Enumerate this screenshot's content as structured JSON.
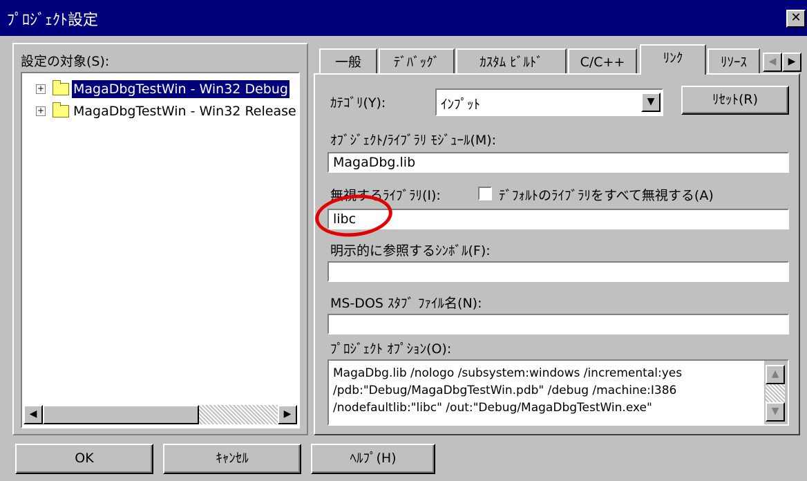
{
  "window": {
    "title": "ﾌﾟﾛｼﾞｪｸﾄ設定",
    "close_glyph": "✕"
  },
  "left": {
    "label": "設定の対象(S):",
    "tree_items": [
      {
        "label": "MagaDbgTestWin - Win32 Debug",
        "selected": true
      },
      {
        "label": "MagaDbgTestWin - Win32 Release",
        "selected": false
      }
    ]
  },
  "tabs": [
    {
      "label": "一般",
      "active": false
    },
    {
      "label": "ﾃﾞﾊﾞｯｸﾞ",
      "active": false
    },
    {
      "label": "ｶｽﾀﾑ ﾋﾞﾙﾄﾞ",
      "active": false
    },
    {
      "label": "C/C++",
      "active": false
    },
    {
      "label": "ﾘﾝｸ",
      "active": true
    },
    {
      "label": "ﾘｿｰｽ",
      "active": false
    }
  ],
  "link": {
    "category_label": "ｶﾃｺﾞﾘ(Y):",
    "category_value": "ｲﾝﾌﾟｯﾄ",
    "reset_label": "ﾘｾｯﾄ(R)",
    "objlib_label": "ｵﾌﾞｼﾞｪｸﾄ/ﾗｲﾌﾞﾗﾘ ﾓｼﾞｭｰﾙ(M):",
    "objlib_value": "MagaDbg.lib",
    "ignore_label": "無視するﾗｲﾌﾞﾗﾘ(I):",
    "ignore_all_label": "ﾃﾞﾌｫﾙﾄのﾗｲﾌﾞﾗﾘをすべて無視する(A)",
    "ignore_all_checked": false,
    "ignore_value": "libc",
    "symbols_label": "明示的に参照するｼﾝﾎﾞﾙ(F):",
    "symbols_value": "",
    "stub_label": "MS-DOS ｽﾀﾌﾞ ﾌｧｲﾙ名(N):",
    "stub_value": "",
    "options_label": "ﾌﾟﾛｼﾞｪｸﾄ ｵﾌﾟｼｮﾝ(O):",
    "options_lines": [
      "MagaDbg.lib /nologo /subsystem:windows /incremental:yes",
      "/pdb:\"Debug/MagaDbgTestWin.pdb\" /debug /machine:I386",
      "/nodefaultlib:\"libc\" /out:\"Debug/MagaDbgTestWin.exe\""
    ]
  },
  "buttons": {
    "ok": "OK",
    "cancel": "ｷｬﾝｾﾙ",
    "help": "ﾍﾙﾌﾟ(H)"
  },
  "annotation": {
    "color": "#e00000"
  }
}
